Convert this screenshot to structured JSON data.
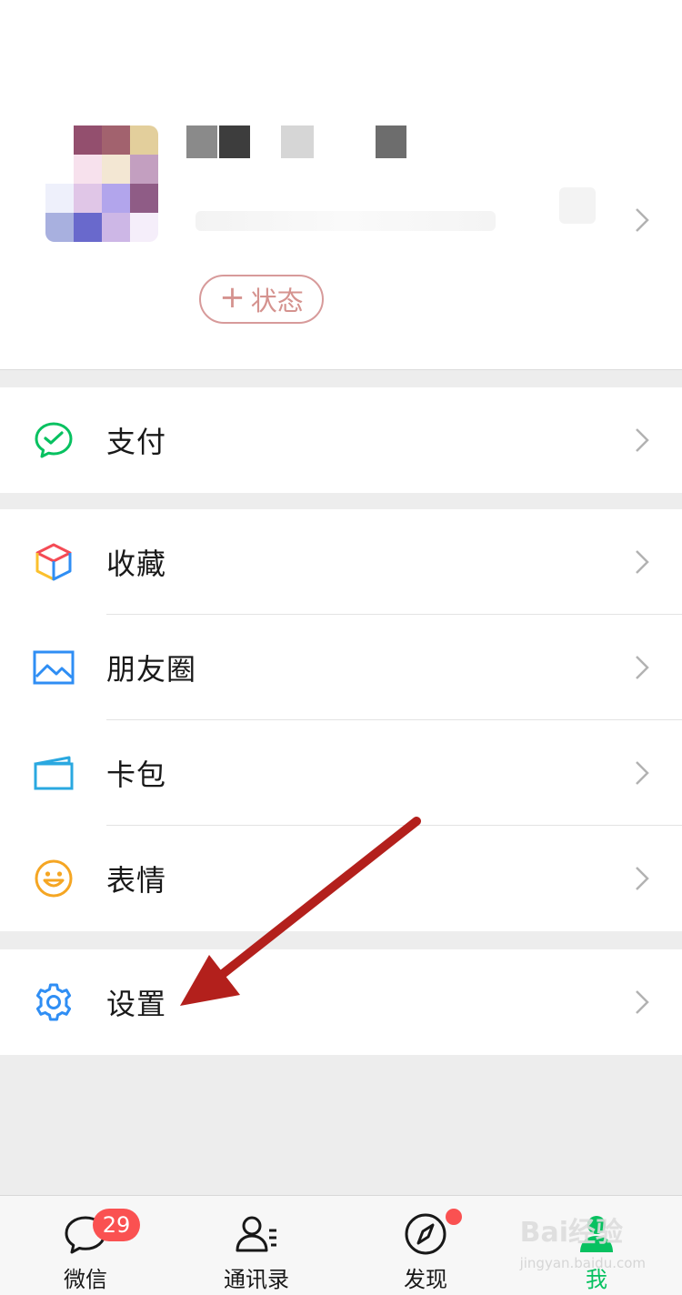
{
  "profile": {
    "status_button": {
      "plus": "+",
      "label": "状态"
    }
  },
  "groups": [
    {
      "items": [
        {
          "label": "支付",
          "icon": "pay-icon"
        }
      ]
    },
    {
      "items": [
        {
          "label": "收藏",
          "icon": "favorites-icon"
        },
        {
          "label": "朋友圈",
          "icon": "moments-icon"
        },
        {
          "label": "卡包",
          "icon": "card-wallet-icon"
        },
        {
          "label": "表情",
          "icon": "sticker-icon"
        }
      ]
    },
    {
      "items": [
        {
          "label": "设置",
          "icon": "settings-icon"
        }
      ]
    }
  ],
  "tabbar": {
    "tabs": [
      {
        "label": "微信",
        "icon": "chat-icon",
        "badge": "29"
      },
      {
        "label": "通讯录",
        "icon": "contacts-icon"
      },
      {
        "label": "发现",
        "icon": "discover-icon"
      },
      {
        "label": "我",
        "icon": "me-icon"
      }
    ]
  },
  "watermark": {
    "text": "Bai经验",
    "sub": "jingyan.baidu.com"
  },
  "colors": {
    "accent": "#07c160",
    "badge": "#fa5151",
    "annotation_arrow": "#b3201c",
    "status_border": "#d79a9a"
  }
}
